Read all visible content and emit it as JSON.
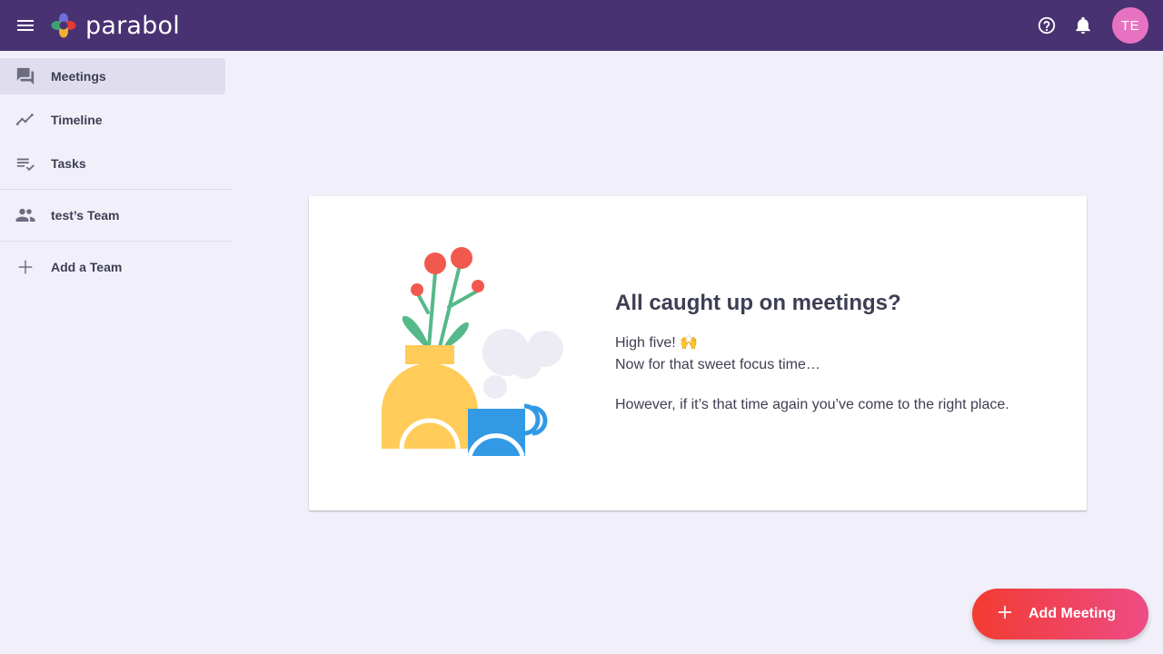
{
  "app": {
    "logo_text": "parabol",
    "avatar_initials": "TE",
    "brand_color": "#493272",
    "accent_color": "#F23B31"
  },
  "topbar": {
    "menu_icon": "hamburger-menu-icon",
    "help_icon": "help-circle-icon",
    "notifications_icon": "bell-icon"
  },
  "sidebar": {
    "items": [
      {
        "label": "Meetings",
        "icon": "forum-icon",
        "active": true
      },
      {
        "label": "Timeline",
        "icon": "timeline-icon",
        "active": false
      },
      {
        "label": "Tasks",
        "icon": "playlist-check-icon",
        "active": false
      }
    ],
    "team": {
      "label": "test’s Team",
      "icon": "group-icon"
    },
    "add_team": {
      "label": "Add a Team",
      "icon": "plus-icon"
    }
  },
  "empty_state": {
    "title": "All caught up on meetings?",
    "line1": "High five! 🙌",
    "line2": "Now for that sweet focus time…",
    "line3": "However, if it’s that time again you’ve come to the right place."
  },
  "fab": {
    "label": "Add Meeting",
    "icon": "plus-icon"
  }
}
